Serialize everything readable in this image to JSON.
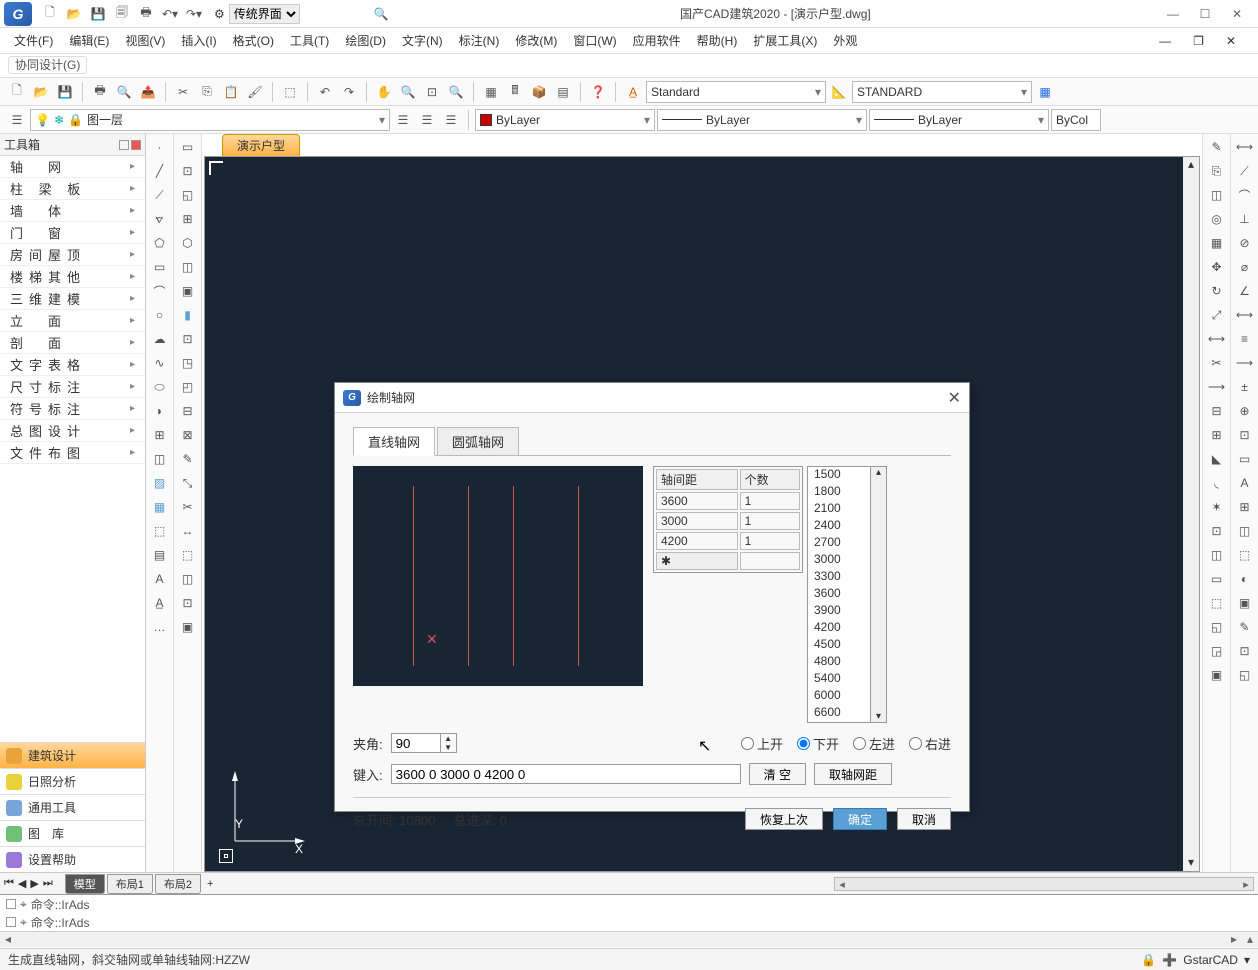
{
  "app": {
    "logo_text": "G",
    "title": "国产CAD建筑2020 - [演示户型.dwg]",
    "workspace": "传统界面"
  },
  "menubar": [
    "文件(F)",
    "编辑(E)",
    "视图(V)",
    "插入(I)",
    "格式(O)",
    "工具(T)",
    "绘图(D)",
    "文字(N)",
    "标注(N)",
    "修改(M)",
    "窗口(W)",
    "应用软件",
    "帮助(H)",
    "扩展工具(X)",
    "外观"
  ],
  "submenu": "协同设计(G)",
  "toolbar": {
    "layer": "图一层",
    "color_label": "ByLayer",
    "linetype": "ByLayer",
    "lineweight": "ByLayer",
    "bycol": "ByCol",
    "text_style": "Standard",
    "dim_style": "STANDARD"
  },
  "leftpanel": {
    "title": "工具箱",
    "items": [
      "轴　网",
      "柱 梁 板",
      "墙　体",
      "门　窗",
      "房间屋顶",
      "楼梯其他",
      "三维建模",
      "立　面",
      "剖　面",
      "文字表格",
      "尺寸标注",
      "符号标注",
      "总图设计",
      "文件布图"
    ],
    "bottom": [
      {
        "label": "建筑设计",
        "color": "#e8a33b"
      },
      {
        "label": "日照分析",
        "color": "#e8d23b"
      },
      {
        "label": "通用工具",
        "color": "#7aa5d8"
      },
      {
        "label": "图　库",
        "color": "#6fc17a"
      },
      {
        "label": "设置帮助",
        "color": "#9a7ad8"
      }
    ]
  },
  "drawtab": "演示户型",
  "dialog": {
    "title": "绘制轴网",
    "tabs": [
      "直线轴网",
      "圆弧轴网"
    ],
    "table_headers": [
      "轴间距",
      "个数"
    ],
    "table_rows": [
      {
        "dist": "3600",
        "count": "1"
      },
      {
        "dist": "3000",
        "count": "1"
      },
      {
        "dist": "4200",
        "count": "1"
      }
    ],
    "preset_values": [
      "1500",
      "1800",
      "2100",
      "2400",
      "2700",
      "3000",
      "3300",
      "3600",
      "3900",
      "4200",
      "4500",
      "4800",
      "5400",
      "6000",
      "6600"
    ],
    "angle_label": "夹角:",
    "angle_value": "90",
    "radios": [
      "上开",
      "下开",
      "左进",
      "右进"
    ],
    "radio_selected": "下开",
    "keyin_label": "键入:",
    "keyin_value": "3600 0 3000 0 4200 0",
    "btn_clear": "清 空",
    "btn_pick": "取轴网距",
    "total_open_label": "总开间:",
    "total_open": "10800",
    "total_depth_label": "总进深:",
    "total_depth": "0",
    "btn_restore": "恢复上次",
    "btn_ok": "确定",
    "btn_cancel": "取消"
  },
  "mtabs": [
    "模型",
    "布局1",
    "布局2"
  ],
  "cmd": {
    "line1": "命令::IrAds",
    "line2": "命令::IrAds"
  },
  "status": {
    "text": "生成直线轴网，斜交轴网或单轴线轴网:HZZW",
    "brand": "GstarCAD"
  }
}
